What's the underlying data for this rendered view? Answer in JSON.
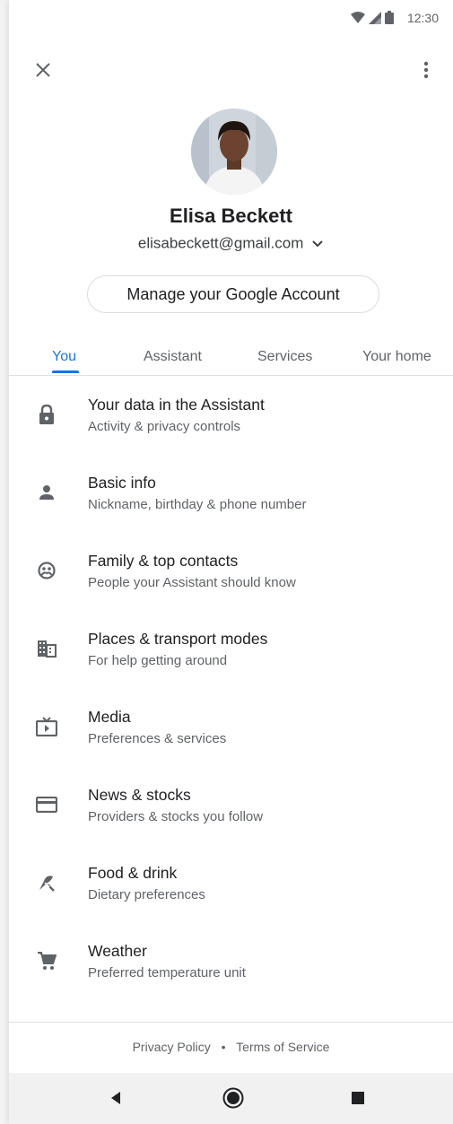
{
  "status_bar": {
    "time": "12:30",
    "wifi_icon": "wifi-icon",
    "signal_icon": "signal-icon",
    "battery_icon": "battery-icon"
  },
  "top_bar": {
    "close_icon": "close-icon",
    "more_icon": "more-vert-icon"
  },
  "profile": {
    "name": "Elisa Beckett",
    "email": "elisabeckett@gmail.com",
    "manage_button": "Manage your Google Account"
  },
  "tabs": [
    {
      "label": "You",
      "active": true
    },
    {
      "label": "Assistant",
      "active": false
    },
    {
      "label": "Services",
      "active": false
    },
    {
      "label": "Your home",
      "active": false
    }
  ],
  "items": [
    {
      "title": "Your data in the Assistant",
      "subtitle": "Activity & privacy controls",
      "icon": "lock-icon"
    },
    {
      "title": "Basic info",
      "subtitle": "Nickname, birthday & phone number",
      "icon": "person-icon"
    },
    {
      "title": "Family & top contacts",
      "subtitle": "People your Assistant should know",
      "icon": "family-icon"
    },
    {
      "title": "Places & transport modes",
      "subtitle": "For help getting around",
      "icon": "building-icon"
    },
    {
      "title": "Media",
      "subtitle": "Preferences & services",
      "icon": "tv-icon"
    },
    {
      "title": "News & stocks",
      "subtitle": "Providers & stocks you follow",
      "icon": "card-icon"
    },
    {
      "title": "Food & drink",
      "subtitle": "Dietary preferences",
      "icon": "food-icon"
    },
    {
      "title": "Weather",
      "subtitle": "Preferred temperature unit",
      "icon": "cart-icon"
    }
  ],
  "footer": {
    "privacy": "Privacy Policy",
    "separator": "•",
    "terms": "Terms of Service"
  },
  "colors": {
    "accent": "#1a73e8",
    "text": "#202124",
    "secondary": "#5f6368"
  }
}
